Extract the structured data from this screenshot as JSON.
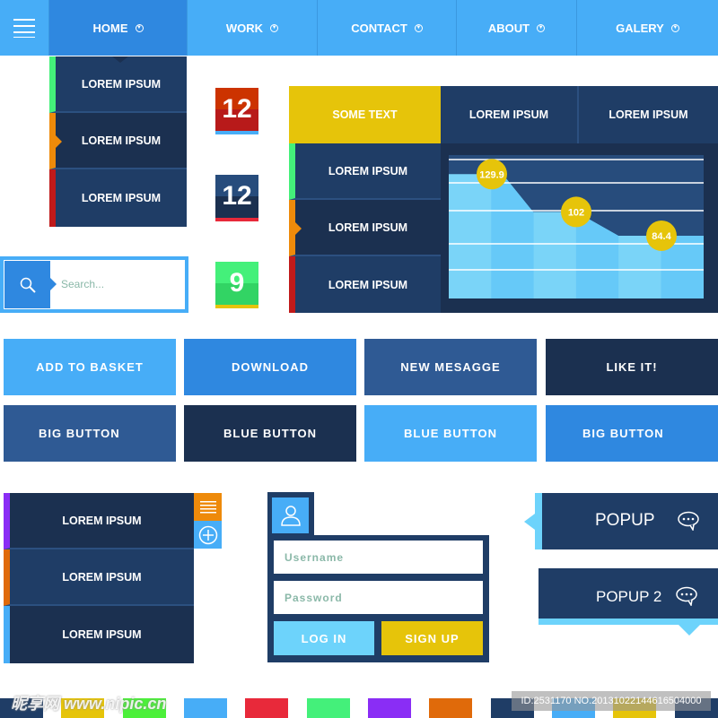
{
  "nav": {
    "items": [
      {
        "label": "HOME"
      },
      {
        "label": "WORK"
      },
      {
        "label": "CONTACT"
      },
      {
        "label": "ABOUT"
      },
      {
        "label": "GALERY"
      }
    ]
  },
  "dropdown": {
    "items": [
      "LOREM IPSUM",
      "LOREM IPSUM",
      "LOREM IPSUM"
    ]
  },
  "tiles": [
    "12",
    "12",
    "9"
  ],
  "search": {
    "placeholder": "Search..."
  },
  "panel": {
    "tabs": [
      "SOME TEXT",
      "LOREM IPSUM",
      "LOREM IPSUM"
    ],
    "items": [
      "LOREM IPSUM",
      "LOREM IPSUM",
      "LOREM IPSUM"
    ]
  },
  "chart_data": {
    "type": "area",
    "values": [
      129.9,
      102,
      84.4
    ],
    "data_labels": [
      "129.9",
      "102",
      "84.4"
    ],
    "ylim": [
      38,
      144
    ],
    "grid": true
  },
  "buttons": [
    "ADD TO BASKET",
    "DOWNLOAD",
    "NEW MESAGGE",
    "LIKE IT!",
    "BIG BUTTON",
    "BLUE BUTTON",
    "BLUE BUTTON",
    "BIG BUTTON"
  ],
  "list2": {
    "items": [
      "LOREM IPSUM",
      "LOREM IPSUM",
      "LOREM IPSUM"
    ]
  },
  "login": {
    "username_placeholder": "Username",
    "password_placeholder": "Password",
    "login": "LOG IN",
    "signup": "SIGN UP"
  },
  "popups": [
    "POPUP",
    "POPUP 2"
  ],
  "watermark": {
    "logo": "昵享网 www.nipic.cn",
    "id": "ID:2531170 NO.20131022144616504000"
  },
  "colors": {
    "light_blue": "#47adf7",
    "blue": "#2f88e0",
    "navy": "#1f3d66",
    "dark_navy": "#1b3050",
    "yellow": "#e6c40a",
    "green": "#44f07a",
    "orange": "#ee8a0a",
    "red": "#c01a1a",
    "purple": "#8a2df5"
  }
}
